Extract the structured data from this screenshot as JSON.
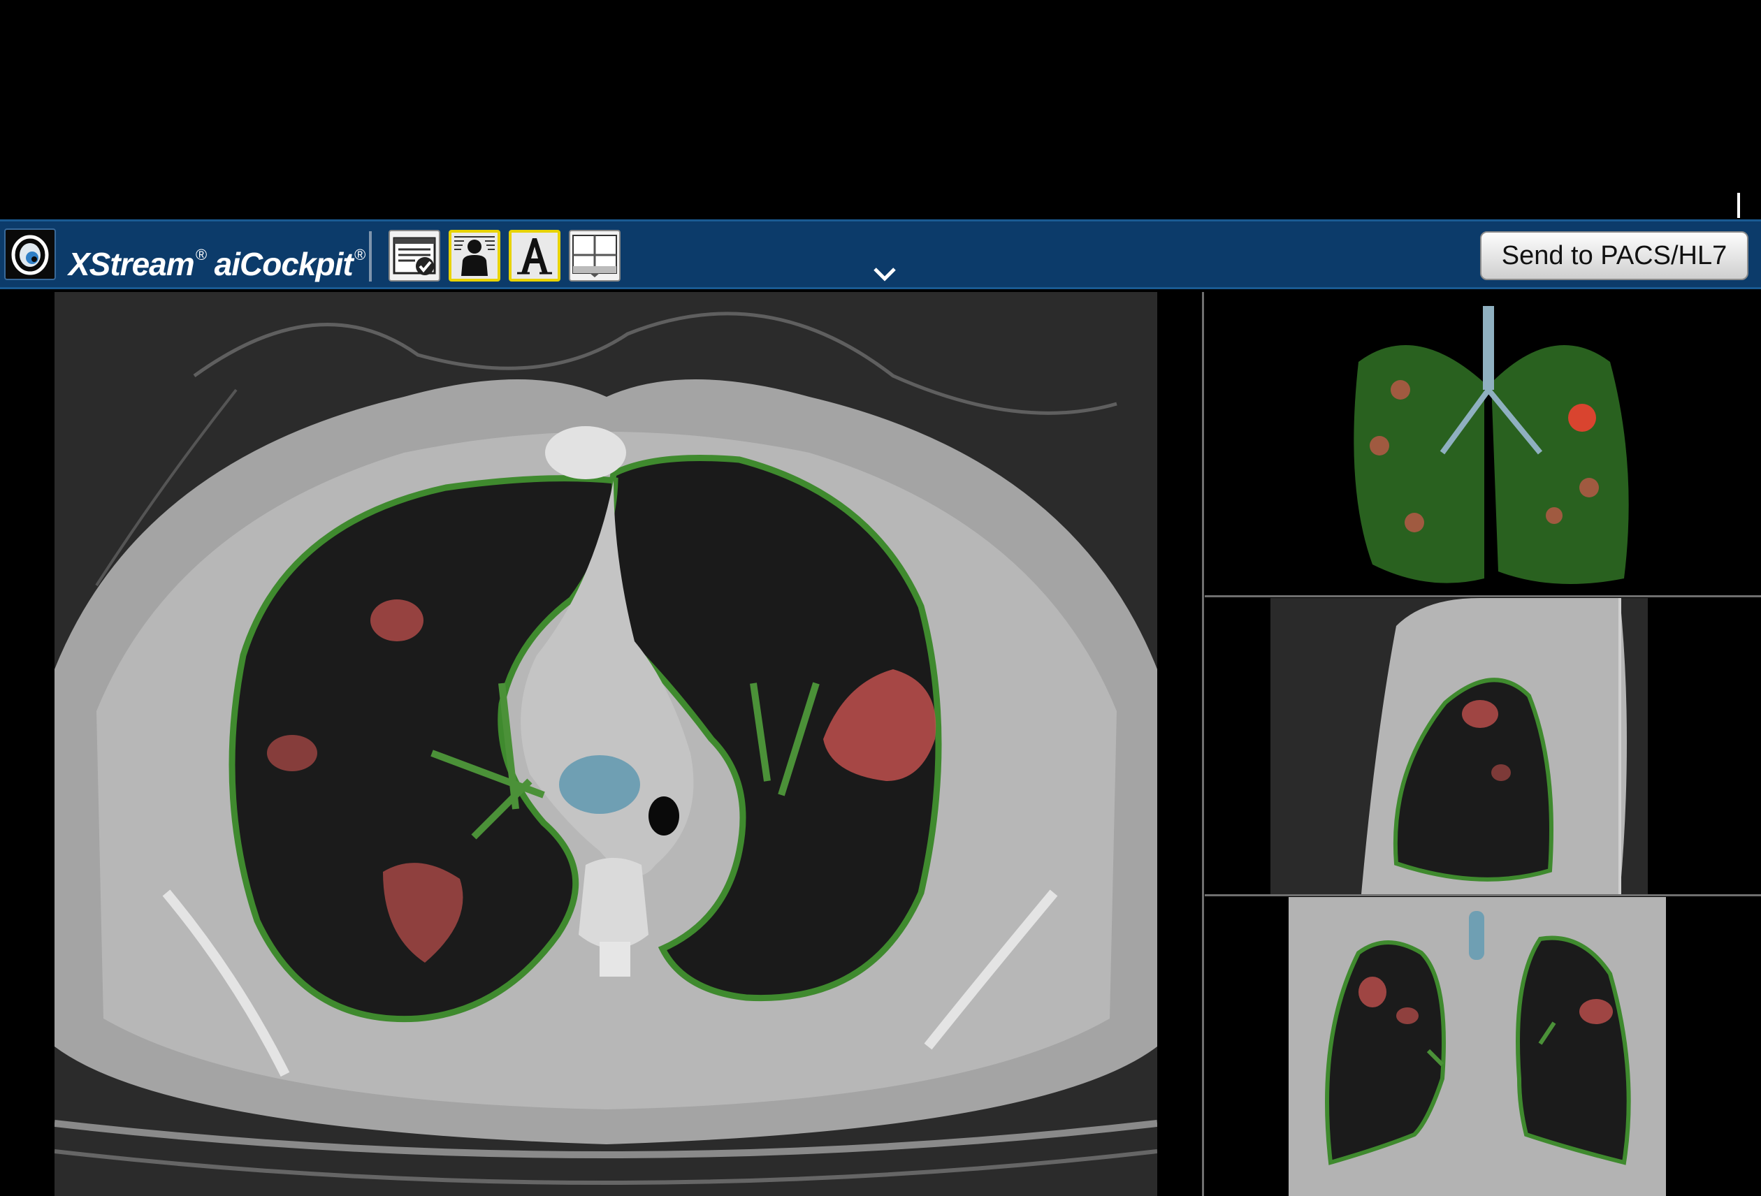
{
  "app": {
    "brand_name": "XStream",
    "brand_mark": "®",
    "product_name": "aiCockpit",
    "product_mark": "®",
    "logo_icon": "eye-logo-icon"
  },
  "toolbar": {
    "buttons": [
      {
        "icon": "report-check-icon",
        "active": false
      },
      {
        "icon": "patient-silhouette-icon",
        "active": true
      },
      {
        "icon": "text-annotation-icon",
        "active": true
      },
      {
        "icon": "layout-grid-icon",
        "active": false
      }
    ],
    "expand_icon": "chevron-down-icon",
    "send_label": "Send to PACS/HL7"
  },
  "viewports": {
    "main": "axial-ct-view",
    "right_top": "3d-lung-render-view",
    "right_middle": "sagittal-ct-view",
    "right_bottom": "coronal-ct-view"
  },
  "colors": {
    "toolbar_bg": "#0c3b6a",
    "lung_outline": "#3f8a2e",
    "lesion": "#c0504d",
    "airway": "#6f9fb3",
    "active_button_border": "#e8d300"
  }
}
